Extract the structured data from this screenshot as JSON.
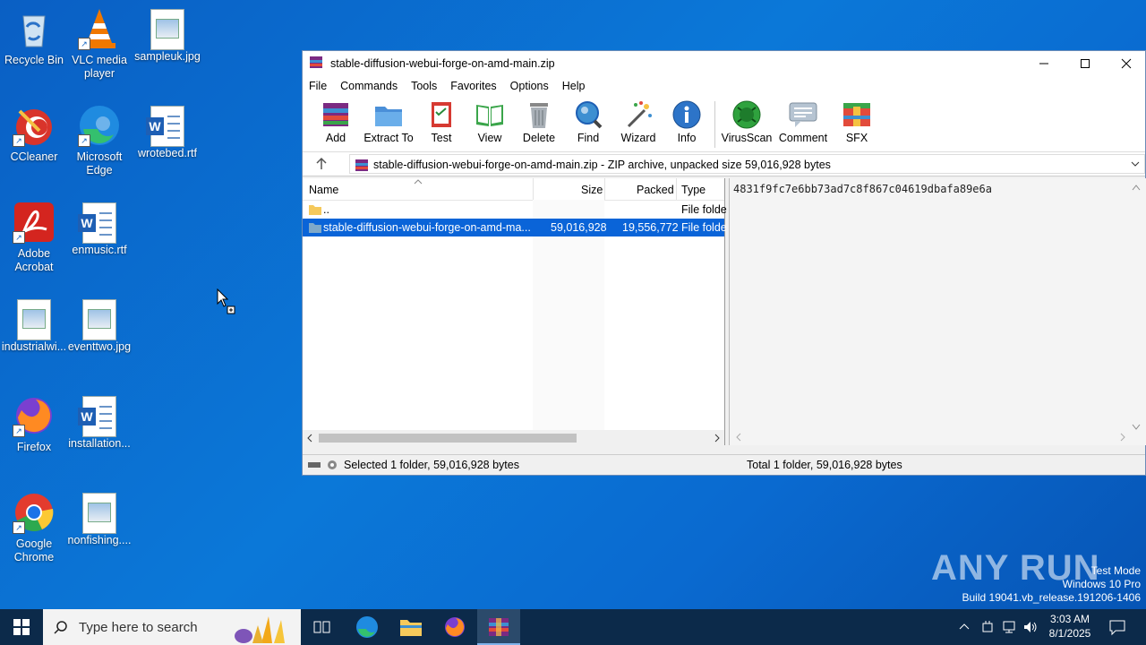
{
  "desktop": {
    "icons": [
      {
        "label": "Recycle Bin"
      },
      {
        "label": "VLC media player"
      },
      {
        "label": "sampleuk.jpg"
      },
      {
        "label": "CCleaner"
      },
      {
        "label": "Microsoft Edge"
      },
      {
        "label": "wrotebed.rtf"
      },
      {
        "label": "Adobe Acrobat"
      },
      {
        "label": "enmusic.rtf"
      },
      {
        "label": "industrialwi..."
      },
      {
        "label": "eventtwo.jpg"
      },
      {
        "label": "Firefox"
      },
      {
        "label": "installation..."
      },
      {
        "label": "Google Chrome"
      },
      {
        "label": "nonfishing...."
      }
    ]
  },
  "window": {
    "title": "stable-diffusion-webui-forge-on-amd-main.zip",
    "menu": [
      "File",
      "Commands",
      "Tools",
      "Favorites",
      "Options",
      "Help"
    ],
    "toolbar": [
      "Add",
      "Extract To",
      "Test",
      "View",
      "Delete",
      "Find",
      "Wizard",
      "Info",
      "VirusScan",
      "Comment",
      "SFX"
    ],
    "address": "stable-diffusion-webui-forge-on-amd-main.zip - ZIP archive, unpacked size 59,016,928 bytes",
    "columns": {
      "name": "Name",
      "size": "Size",
      "packed": "Packed",
      "type": "Type"
    },
    "rows": [
      {
        "name": "..",
        "size": "",
        "packed": "",
        "type": "File folde"
      },
      {
        "name": "stable-diffusion-webui-forge-on-amd-ma...",
        "size": "59,016,928",
        "packed": "19,556,772",
        "type": "File folde"
      }
    ],
    "comment_text": "4831f9fc7e6bb73ad7c8f867c04619dbafa89e6a",
    "status_left": "Selected 1 folder, 59,016,928 bytes",
    "status_right": "Total 1 folder, 59,016,928 bytes"
  },
  "watermark": {
    "brand": "ANY RUN",
    "mode": "Test Mode",
    "os": "Windows 10 Pro",
    "build": "Build 19041.vb_release.191206-1406"
  },
  "taskbar": {
    "search_placeholder": "Type here to search",
    "time": "3:03 AM",
    "date": "8/1/2025"
  }
}
